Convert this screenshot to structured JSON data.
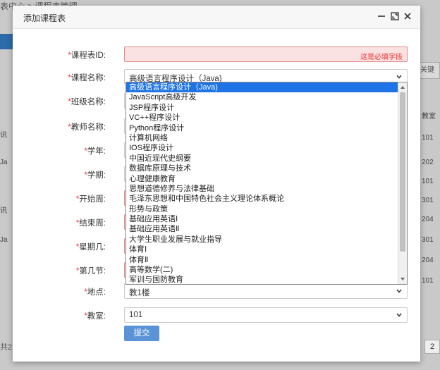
{
  "background": {
    "breadcrumb": "表中心 > 课程表管理",
    "search_hint": "关键",
    "col_header": "教室",
    "col_values": [
      "101",
      "202",
      "101",
      "301",
      "204",
      "301",
      "204",
      "101"
    ],
    "left_values": [
      "讯",
      "Ja",
      "讯",
      "Ja"
    ],
    "footer": "共2",
    "page": "2"
  },
  "modal": {
    "title": "添加课程表",
    "fields": [
      {
        "label": "课程表ID:",
        "required": true,
        "value": "",
        "error": "这是必填字段"
      },
      {
        "label": "课程名称:",
        "required": true,
        "value": "高级语言程序设计（Java)"
      },
      {
        "label": "班级名称:",
        "required": true,
        "value": ""
      },
      {
        "label": "教师名称:",
        "required": true,
        "value": ""
      },
      {
        "label": "学年:",
        "required": true,
        "value": ""
      },
      {
        "label": "学期:",
        "required": true,
        "value": ""
      },
      {
        "label": "开始周:",
        "required": true,
        "value": ""
      },
      {
        "label": "结束周:",
        "required": true,
        "value": ""
      },
      {
        "label": "星期几:",
        "required": true,
        "value": ""
      },
      {
        "label": "第几节:",
        "required": true,
        "value": ""
      },
      {
        "label": "地点:",
        "required": true,
        "value": "教1楼"
      },
      {
        "label": "教室:",
        "required": true,
        "value": "101"
      }
    ],
    "submit_label": "提交"
  },
  "dropdown": {
    "selected_index": 0,
    "options": [
      "高级语言程序设计（Java)",
      "JavaScript高级开发",
      "JSP程序设计",
      "VC++程序设计",
      "Python程序设计",
      "计算机网络",
      "IOS程序设计",
      "中国近现代史纲要",
      "数据库原理与技术",
      "心理健康教育",
      "思想道德修养与法律基础",
      "毛泽东思想和中国特色社会主义理论体系概论",
      "形势与政策",
      "基础应用英语Ⅰ",
      "基础应用英语Ⅱ",
      "大学生职业发展与就业指导",
      "体育Ⅰ",
      "体育Ⅱ",
      "高等数学(二)",
      "军训与国防教育"
    ]
  },
  "colors": {
    "accent": "#1e74e6",
    "button": "#5b94d6",
    "error": "#e33333",
    "error_bg": "#fbe2e2"
  }
}
